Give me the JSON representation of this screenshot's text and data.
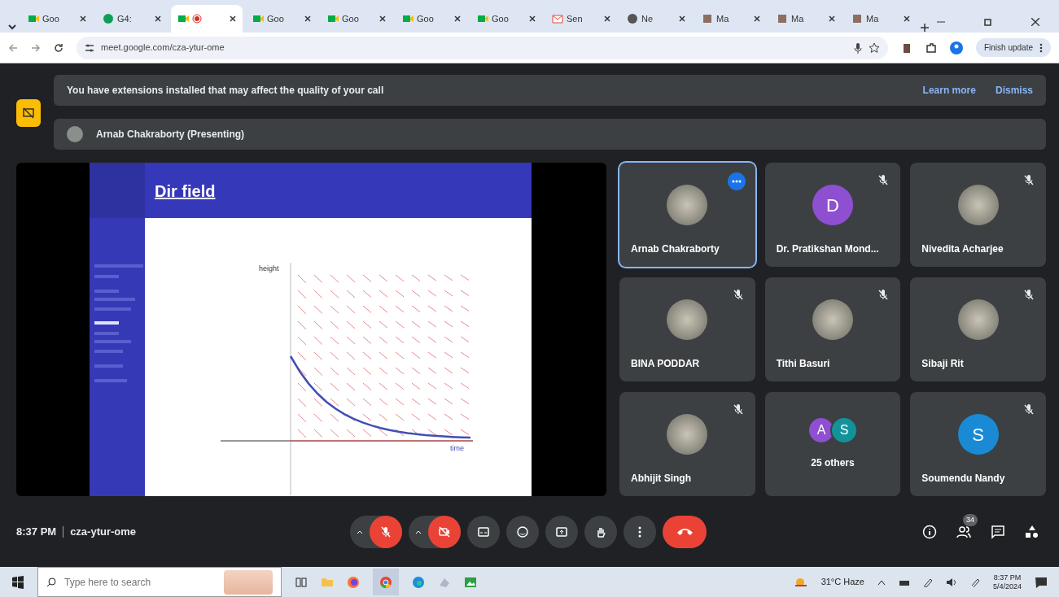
{
  "browser": {
    "tabs": [
      {
        "kind": "meet",
        "title": "Goo",
        "selected": false,
        "recording": false
      },
      {
        "kind": "green",
        "title": "G4:",
        "selected": false,
        "recording": false
      },
      {
        "kind": "meet",
        "selected": true,
        "recording": true
      },
      {
        "kind": "meet",
        "title": "Goo",
        "selected": false,
        "recording": false
      },
      {
        "kind": "meet",
        "title": "Goo",
        "selected": false,
        "recording": false
      },
      {
        "kind": "meet",
        "title": "Goo",
        "selected": false,
        "recording": false
      },
      {
        "kind": "meet",
        "title": "Goo",
        "selected": false,
        "recording": false
      },
      {
        "kind": "gmail",
        "title": "Sen",
        "selected": false,
        "recording": false
      },
      {
        "kind": "globe",
        "title": "Ne",
        "selected": false,
        "recording": false
      },
      {
        "kind": "app",
        "title": "Ma",
        "selected": false,
        "recording": false
      },
      {
        "kind": "app",
        "title": "Ma",
        "selected": false,
        "recording": false
      },
      {
        "kind": "app",
        "title": "Ma",
        "selected": false,
        "recording": false
      }
    ],
    "address": "meet.google.com/cza-ytur-ome",
    "update_button": "Finish update"
  },
  "meet": {
    "banner": {
      "message": "You have extensions installed that may affect the quality of your call",
      "actions": [
        "Learn more",
        "Dismiss"
      ]
    },
    "presenter": "Arnab Chakraborty (Presenting)",
    "slide": {
      "title": "Dir field",
      "y_label": "height",
      "x_label": "time"
    },
    "participants": [
      {
        "name": "Arnab Chakraborty",
        "kind": "photo",
        "selected": true,
        "muted": false
      },
      {
        "name": "Dr. Pratikshan Mond...",
        "kind": "initial",
        "initial": "D",
        "color": "#8e4fd0",
        "selected": false,
        "muted": true
      },
      {
        "name": "Nivedita Acharjee",
        "kind": "photo",
        "selected": false,
        "muted": true
      },
      {
        "name": "BINA PODDAR",
        "kind": "photo",
        "selected": false,
        "muted": true
      },
      {
        "name": "Tithi Basuri",
        "kind": "photo",
        "selected": false,
        "muted": true
      },
      {
        "name": "Sibaji Rit",
        "kind": "photo",
        "selected": false,
        "muted": true
      },
      {
        "name": "Abhijit Singh",
        "kind": "photo",
        "selected": false,
        "muted": true
      },
      {
        "name": "25 others",
        "kind": "group",
        "initials": [
          {
            "letter": "A",
            "color": "#8e4fd0"
          },
          {
            "letter": "S",
            "color": "#12939a"
          }
        ],
        "selected": false,
        "muted": false
      },
      {
        "name": "Soumendu Nandy",
        "kind": "initial",
        "initial": "S",
        "color": "#1a8ad4",
        "selected": false,
        "muted": true
      }
    ],
    "time": "8:37 PM",
    "meeting_code": "cza-ytur-ome",
    "controls": [
      {
        "kind": "mic",
        "on": false
      },
      {
        "kind": "camera",
        "on": false
      },
      {
        "kind": "captions"
      },
      {
        "kind": "emoji"
      },
      {
        "kind": "present"
      },
      {
        "kind": "hand"
      },
      {
        "kind": "more"
      },
      {
        "kind": "end"
      }
    ],
    "people_count": "34"
  },
  "taskbar": {
    "search_placeholder": "Type here to search",
    "weather": "31°C  Haze",
    "time": "8:37 PM",
    "date": "5/4/2024"
  }
}
